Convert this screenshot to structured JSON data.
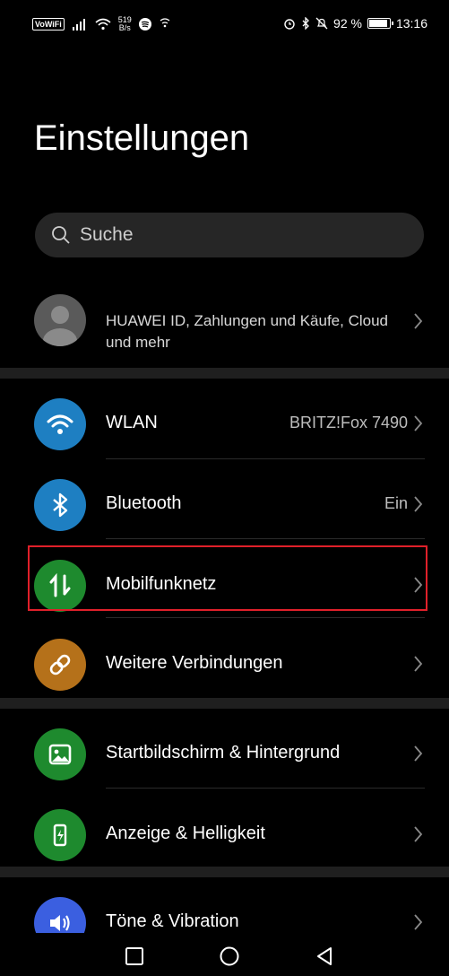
{
  "status_bar": {
    "volte": "VoWiFi",
    "net_speed_value": "519",
    "net_speed_unit": "B/s",
    "battery_text": "92 %",
    "battery_level": 0.92,
    "time": "13:16"
  },
  "title": "Einstellungen",
  "search": {
    "placeholder": "Suche"
  },
  "account": {
    "label": "HUAWEI ID, Zahlungen und Käufe, Cloud und mehr"
  },
  "items": [
    {
      "label": "WLAN",
      "value": "BRITZ!Fox 7490",
      "icon": "wifi-icon",
      "color": "#1e7fc2"
    },
    {
      "label": "Bluetooth",
      "value": "Ein",
      "icon": "bluetooth-icon",
      "color": "#1e7fc2"
    },
    {
      "label": "Mobilfunknetz",
      "value": "",
      "icon": "mobile-data-icon",
      "color": "#1e8a2e"
    },
    {
      "label": "Weitere Verbindungen",
      "value": "",
      "icon": "link-icon",
      "color": "#b5711a"
    },
    {
      "label": "Startbildschirm & Hintergrund",
      "value": "",
      "icon": "image-icon",
      "color": "#1e8a2e"
    },
    {
      "label": "Anzeige & Helligkeit",
      "value": "",
      "icon": "brightness-icon",
      "color": "#1e8a2e"
    },
    {
      "label": "Töne & Vibration",
      "value": "",
      "icon": "speaker-icon",
      "color": "#3b5fe0"
    }
  ],
  "highlight_color": "#e0202a"
}
